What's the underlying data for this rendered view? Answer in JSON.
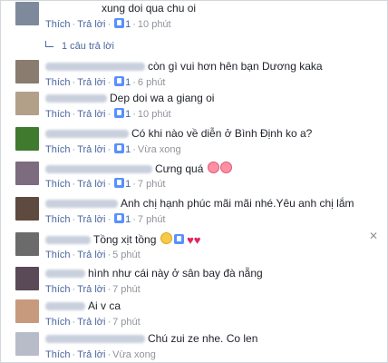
{
  "actions": {
    "like": "Thích",
    "reply": "Trả lời",
    "sep": "·"
  },
  "comments": [
    {
      "text": "xung doi qua chu oi",
      "likes": "1",
      "time": "10 phút",
      "avatar_color": "#7e8a9c",
      "name_w": 0
    },
    {
      "text": "còn gì vui hơn hên bạn Dương kaka",
      "likes": "1",
      "time": "6 phút",
      "avatar_color": "#8a7c6e",
      "name_w": 110
    },
    {
      "text": "Dep doi wa a giang oi",
      "likes": "1",
      "time": "10 phút",
      "avatar_color": "#b3a089",
      "name_w": 68
    },
    {
      "text": "Có khi nào về diễn ở Bình Định ko a?",
      "likes": "1",
      "time": "Vừa xong",
      "avatar_color": "#3f7a2e",
      "name_w": 92
    },
    {
      "text": "Cưng quá",
      "likes": "1",
      "time": "7 phút",
      "avatar_color": "#7d6b7f",
      "name_w": 118
    },
    {
      "text": "Anh chị hạnh phúc mãi mãi nhé.Yêu anh chị lắm",
      "likes": "1",
      "time": "7 phút",
      "avatar_color": "#5e4a3e",
      "name_w": 80
    },
    {
      "text": "Tồng xịt tồng",
      "likes": "",
      "time": "5 phút",
      "avatar_color": "#6b6b6b",
      "name_w": 50
    },
    {
      "text": "hình như cái này ở sân bay đà nẵng",
      "likes": "",
      "time": "7 phút",
      "avatar_color": "#5a4a58",
      "name_w": 44
    },
    {
      "text": "Ai v ca",
      "likes": "",
      "time": "7 phút",
      "avatar_color": "#c79a7e",
      "name_w": 44
    },
    {
      "text": "Chú zui ze nhe. Co len",
      "likes": "",
      "time": "Vừa xong",
      "avatar_color": "#b8bcc8",
      "name_w": 110
    }
  ],
  "replies_link": "1 câu trả lời",
  "close": "✕"
}
